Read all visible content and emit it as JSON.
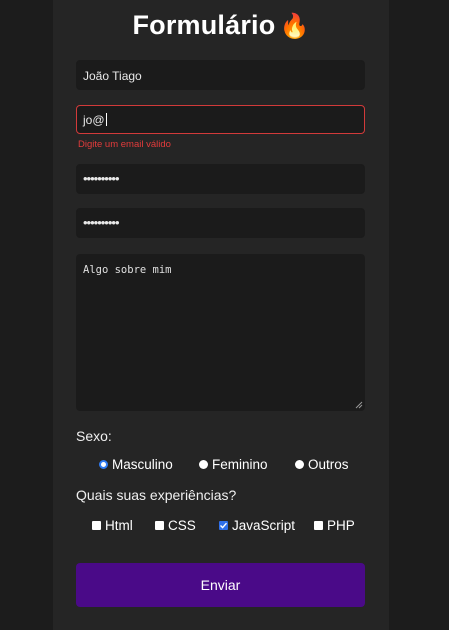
{
  "form": {
    "title": "Formulário",
    "title_icon": "fire-icon",
    "name_value": "João Tiago",
    "email_value": "jo@",
    "email_error": "Digite um email válido",
    "password_mask": "••••••••••",
    "confirm_password_mask": "••••••••••",
    "about_placeholder": "Algo sobre mim",
    "sexo_label": "Sexo:",
    "sexo_options": [
      {
        "label": "Masculino",
        "checked": true
      },
      {
        "label": "Feminino",
        "checked": false
      },
      {
        "label": "Outros",
        "checked": false
      }
    ],
    "experience_label": "Quais suas experiências?",
    "experience_options": [
      {
        "label": "Html",
        "checked": false
      },
      {
        "label": "CSS",
        "checked": false
      },
      {
        "label": "JavaScript",
        "checked": true
      },
      {
        "label": "PHP",
        "checked": false
      }
    ],
    "submit_label": "Enviar",
    "colors": {
      "background": "#1d1d1d",
      "panel": "#252525",
      "field": "#1b1b1b",
      "error": "#e33b3b",
      "accent": "#2f7af0",
      "button": "#4a0a88"
    }
  }
}
